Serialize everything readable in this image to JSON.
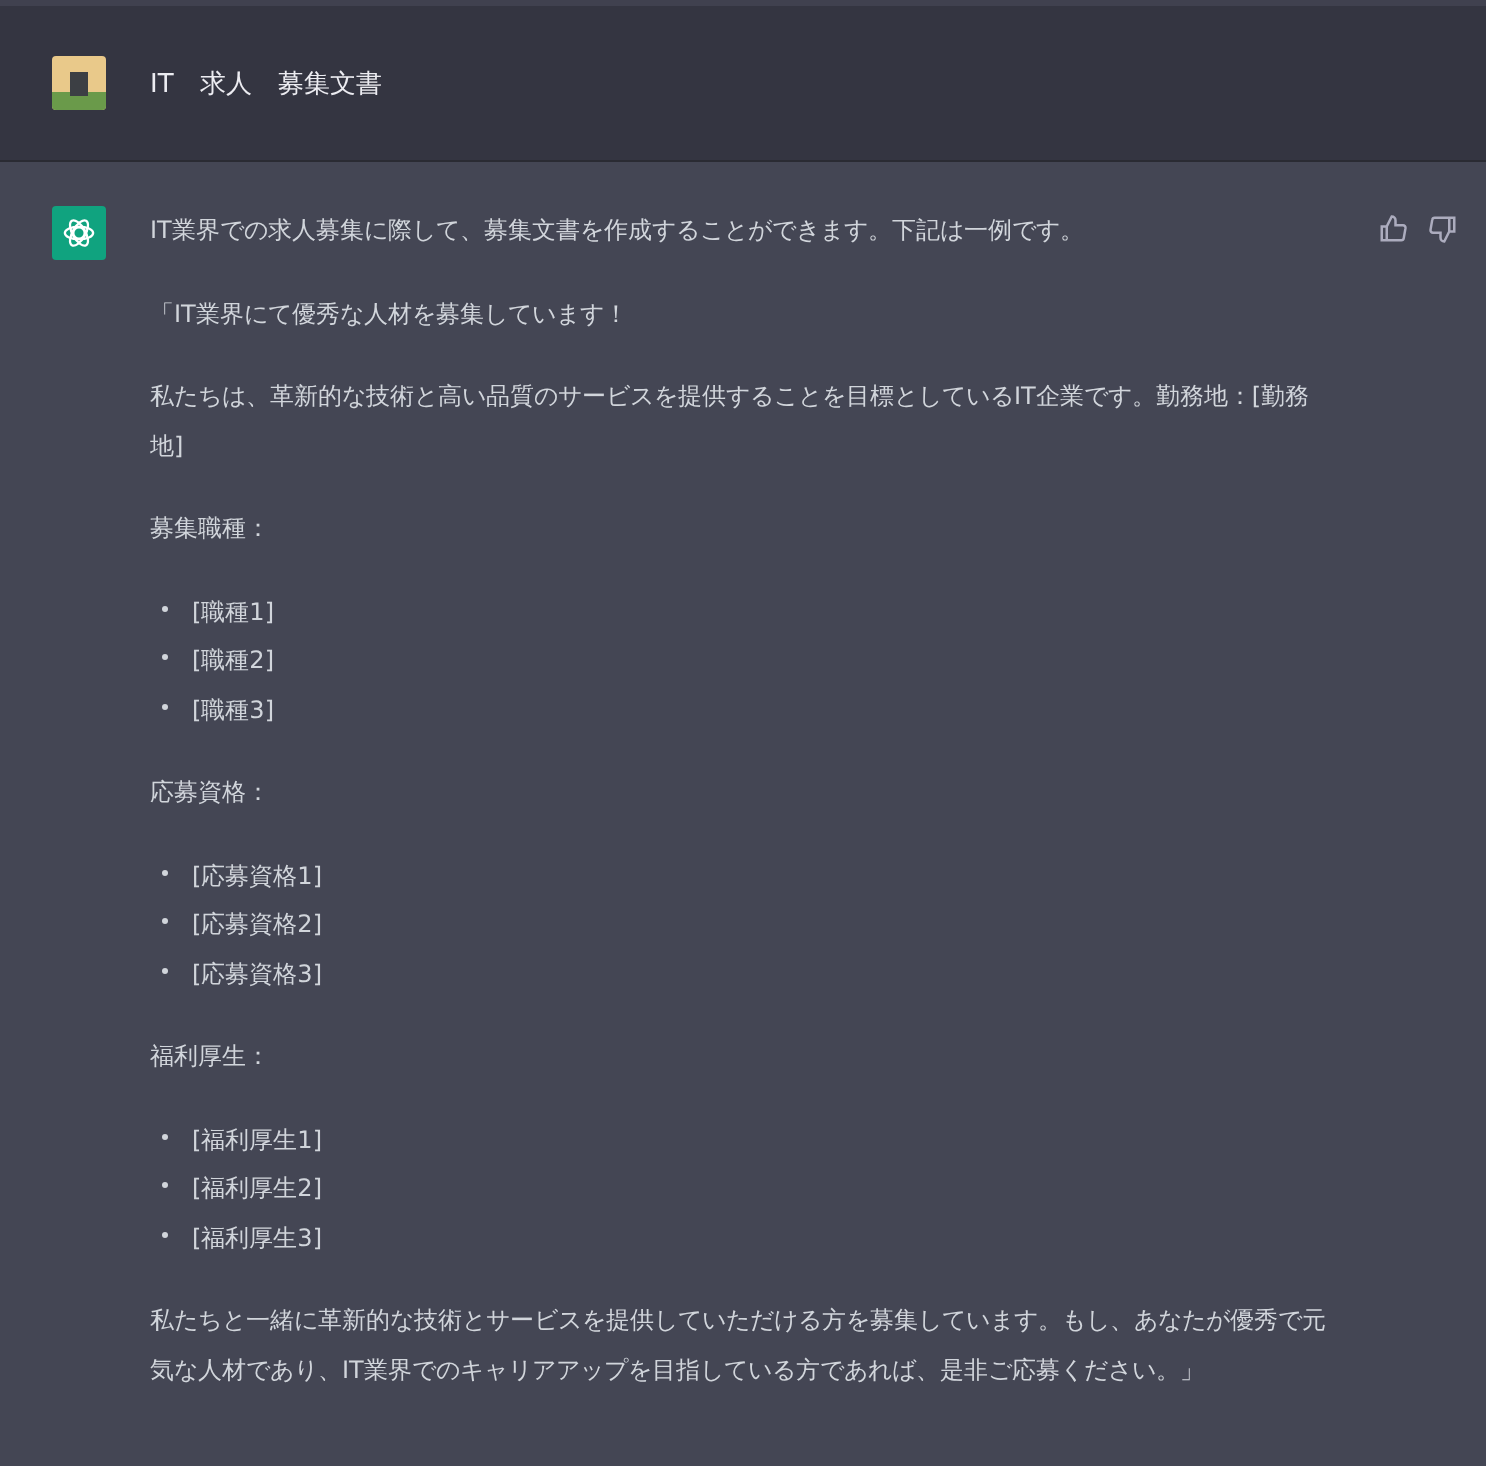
{
  "header": {
    "title": "IT　求人　募集文書"
  },
  "message": {
    "blocks": [
      {
        "kind": "paragraph",
        "text": "IT業界での求人募集に際して、募集文書を作成することができます。下記は一例です。"
      },
      {
        "kind": "paragraph",
        "text": "「IT業界にて優秀な人材を募集しています！"
      },
      {
        "kind": "paragraph",
        "text": "私たちは、革新的な技術と高い品質のサービスを提供することを目標としているIT企業です。勤務地：[勤務地]"
      },
      {
        "kind": "paragraph",
        "text": "募集職種："
      },
      {
        "kind": "list",
        "items": [
          "[職種1]",
          "[職種2]",
          "[職種3]"
        ]
      },
      {
        "kind": "paragraph",
        "text": "応募資格："
      },
      {
        "kind": "list",
        "items": [
          "[応募資格1]",
          "[応募資格2]",
          "[応募資格3]"
        ]
      },
      {
        "kind": "paragraph",
        "text": "福利厚生："
      },
      {
        "kind": "list",
        "items": [
          "[福利厚生1]",
          "[福利厚生2]",
          "[福利厚生3]"
        ]
      },
      {
        "kind": "paragraph",
        "text": "私たちと一緒に革新的な技術とサービスを提供していただける方を募集しています。もし、あなたが優秀で元気な人材であり、IT業界でのキャリアアップを目指している方であれば、是非ご応募ください。」"
      }
    ]
  }
}
